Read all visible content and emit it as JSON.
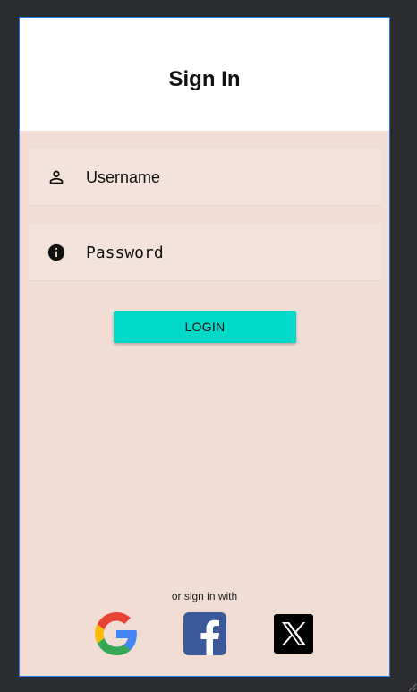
{
  "header": {
    "title": "Sign In"
  },
  "form": {
    "username": {
      "placeholder": "Username",
      "icon": "person-icon"
    },
    "password": {
      "placeholder": "Password",
      "icon": "info-icon"
    },
    "login_label": "LOGIN"
  },
  "social": {
    "prompt": "or sign in with",
    "providers": [
      {
        "name": "Google",
        "icon": "google-logo-icon"
      },
      {
        "name": "Facebook",
        "icon": "facebook-logo-icon"
      },
      {
        "name": "X",
        "icon": "x-logo-icon"
      }
    ]
  },
  "colors": {
    "background": "#f1ddd4",
    "header": "#ffffff",
    "field": "#f4e3dc",
    "accent": "#00d9c8",
    "frame_border": "#1e7cf2",
    "canvas": "#2b2c30"
  }
}
